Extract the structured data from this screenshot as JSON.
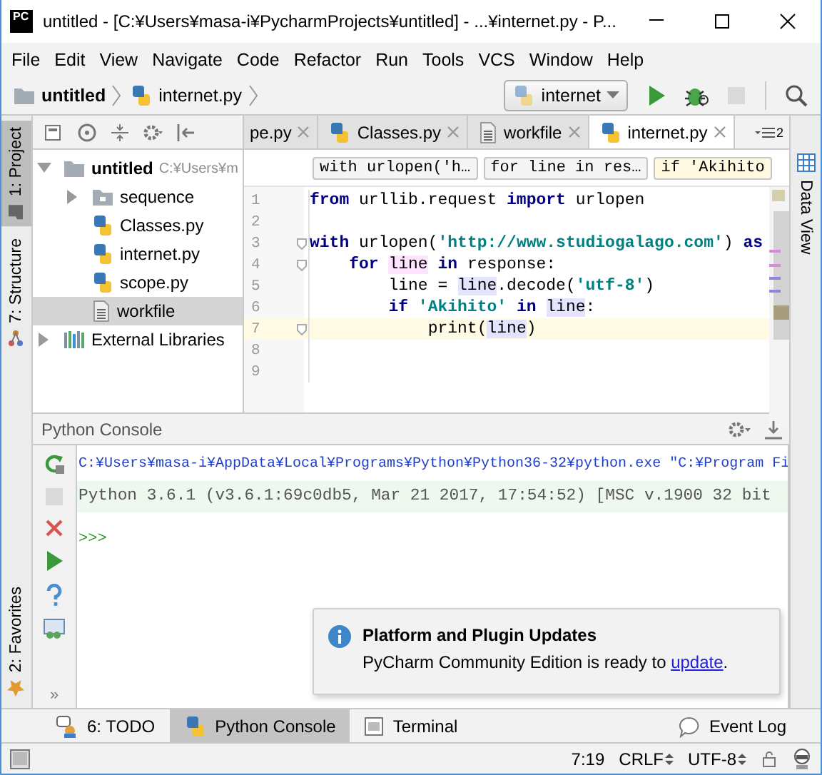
{
  "window": {
    "logo": "PC",
    "title": "untitled - [C:¥Users¥masa-i¥PycharmProjects¥untitled] - ...¥internet.py - P..."
  },
  "menu": [
    "File",
    "Edit",
    "View",
    "Navigate",
    "Code",
    "Refactor",
    "Run",
    "Tools",
    "VCS",
    "Window",
    "Help"
  ],
  "nav": {
    "breadcrumbs": [
      {
        "label": "untitled",
        "kind": "folder"
      },
      {
        "label": "internet.py",
        "kind": "python"
      }
    ],
    "run_config": "internet",
    "actions": [
      {
        "kind": "run",
        "disabled": false
      },
      {
        "kind": "debug",
        "disabled": false
      },
      {
        "kind": "stop",
        "disabled": true
      },
      {
        "kind": "search",
        "disabled": false
      }
    ]
  },
  "left_stripe": {
    "top": [
      {
        "label": "1: Project",
        "kind": "project",
        "selected": true
      },
      {
        "label": "7: Structure",
        "kind": "structure",
        "selected": false
      }
    ],
    "bottom": [
      {
        "label": "2: Favorites",
        "kind": "favorites",
        "selected": false
      }
    ]
  },
  "right_stripe": [
    {
      "label": "Data View",
      "kind": "data",
      "selected": false
    }
  ],
  "project": {
    "tree": [
      {
        "label": "untitled",
        "path": "C:¥Users¥m",
        "kind": "folder",
        "expanded": true,
        "selected": false,
        "children": [
          {
            "label": "sequence",
            "kind": "package",
            "expanded": false,
            "selected": false
          },
          {
            "label": "Classes.py",
            "kind": "python",
            "selected": false
          },
          {
            "label": "internet.py",
            "kind": "python",
            "selected": false
          },
          {
            "label": "scope.py",
            "kind": "python",
            "selected": false
          },
          {
            "label": "workfile",
            "kind": "text",
            "selected": true
          }
        ]
      },
      {
        "label": "External Libraries",
        "kind": "library",
        "expanded": false,
        "selected": false
      }
    ]
  },
  "editor": {
    "tabs": [
      {
        "label": "pe.py",
        "selected": false
      },
      {
        "label": "Classes.py",
        "kind": "python",
        "selected": false
      },
      {
        "label": "workfile",
        "kind": "text",
        "selected": false
      },
      {
        "label": "internet.py",
        "kind": "python",
        "selected": true
      }
    ],
    "overflow_count": "2",
    "breadcrumbs": [
      {
        "label": "with urlopen('h…",
        "selected": false
      },
      {
        "label": "for line in res…",
        "selected": false
      },
      {
        "label": "if 'Akihito",
        "selected": true
      }
    ],
    "lines": [
      {
        "number": "1",
        "current": false,
        "fold": false,
        "tokens": [
          {
            "kind": "kw",
            "text": "from"
          },
          {
            "kind": "plain",
            "text": " urllib.request "
          },
          {
            "kind": "kw",
            "text": "import"
          },
          {
            "kind": "plain",
            "text": " urlopen"
          }
        ]
      },
      {
        "number": "2",
        "current": false,
        "fold": false
      },
      {
        "number": "3",
        "current": false,
        "fold": true,
        "tokens": [
          {
            "kind": "kw",
            "text": "with"
          },
          {
            "kind": "plain",
            "text": " urlopen("
          },
          {
            "kind": "str",
            "text": "'http://www.studiogalago.com'"
          },
          {
            "kind": "plain",
            "text": ") "
          },
          {
            "kind": "kw",
            "text": "as"
          }
        ]
      },
      {
        "number": "4",
        "current": false,
        "fold": true,
        "tokens": [
          {
            "kind": "kw",
            "text": "    for "
          },
          {
            "kind": "write",
            "text": "line"
          },
          {
            "kind": "kw",
            "text": " in"
          },
          {
            "kind": "plain",
            "text": " response:"
          }
        ]
      },
      {
        "number": "5",
        "current": false,
        "fold": false,
        "tokens": [
          {
            "kind": "plain",
            "text": "        line = "
          },
          {
            "kind": "read",
            "text": "line"
          },
          {
            "kind": "plain",
            "text": ".decode("
          },
          {
            "kind": "str",
            "text": "'utf-8'"
          },
          {
            "kind": "plain",
            "text": ")"
          }
        ]
      },
      {
        "number": "6",
        "current": false,
        "fold": false,
        "tokens": [
          {
            "kind": "kw",
            "text": "        if "
          },
          {
            "kind": "str",
            "text": "'Akihito'"
          },
          {
            "kind": "kw",
            "text": " in "
          },
          {
            "kind": "read",
            "text": "line"
          },
          {
            "kind": "plain",
            "text": ":"
          }
        ]
      },
      {
        "number": "7",
        "current": true,
        "fold": true,
        "tokens": [
          {
            "kind": "plain",
            "text": "            print("
          },
          {
            "kind": "read",
            "text": "line"
          },
          {
            "kind": "plain",
            "text": ")"
          }
        ]
      },
      {
        "number": "8",
        "current": false,
        "fold": false
      },
      {
        "number": "9",
        "current": false,
        "fold": false
      }
    ]
  },
  "console": {
    "title": "Python Console",
    "tools": [
      {
        "kind": "rerun",
        "disabled": false
      },
      {
        "kind": "stop",
        "disabled": true
      },
      {
        "kind": "close",
        "disabled": false
      },
      {
        "kind": "run",
        "disabled": false
      },
      {
        "kind": "help",
        "disabled": false
      },
      {
        "kind": "variables",
        "disabled": false
      }
    ],
    "more": "»",
    "output": [
      {
        "kind": "command",
        "text": "C:¥Users¥masa-i¥AppData¥Local¥Programs¥Python¥Python36-32¥python.exe \"C:¥Program Fi"
      },
      {
        "kind": "banner",
        "text": "Python 3.6.1 (v3.6.1:69c0db5, Mar 21 2017, 17:54:52) [MSC v.1900 32 bit"
      },
      {
        "kind": "prompt",
        "text": ">>>"
      }
    ]
  },
  "notification": {
    "title": "Platform and Plugin Updates",
    "text": "PyCharm Community Edition is ready to ",
    "link": "update",
    "after": "."
  },
  "bottom_tabs": [
    {
      "label": "6: TODO",
      "kind": "todo",
      "selected": false
    },
    {
      "label": "Python Console",
      "kind": "python",
      "selected": true
    },
    {
      "label": "Terminal",
      "kind": "terminal",
      "selected": false
    }
  ],
  "event_log": "Event Log",
  "status_bar": {
    "position": "7:19",
    "line_separator": "CRLF",
    "encoding": "UTF-8"
  }
}
